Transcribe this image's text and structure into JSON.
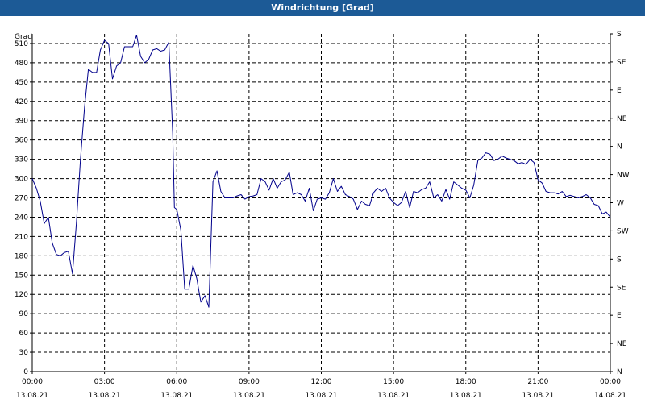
{
  "title": "Windrichtung [Grad]",
  "chart_data": {
    "type": "line",
    "title": "Windrichtung [Grad]",
    "ylabel": "Grad",
    "ylim": [
      0,
      525
    ],
    "yticks": [
      0,
      30,
      60,
      90,
      120,
      150,
      180,
      210,
      240,
      270,
      300,
      330,
      360,
      390,
      420,
      450,
      480,
      510
    ],
    "right_axis_labels": [
      {
        "value": 0,
        "label": "N"
      },
      {
        "value": 45,
        "label": "NE"
      },
      {
        "value": 90,
        "label": "E"
      },
      {
        "value": 135,
        "label": "SE"
      },
      {
        "value": 180,
        "label": "S"
      },
      {
        "value": 225,
        "label": "SW"
      },
      {
        "value": 270,
        "label": "W"
      },
      {
        "value": 315,
        "label": "NW"
      },
      {
        "value": 360,
        "label": "N"
      },
      {
        "value": 405,
        "label": "NE"
      },
      {
        "value": 450,
        "label": "E"
      },
      {
        "value": 495,
        "label": "SE"
      },
      {
        "value": 540,
        "label": "S"
      }
    ],
    "xlim": [
      0,
      24
    ],
    "xticks": [
      {
        "hour": 0,
        "time": "00:00",
        "date": "13.08.21"
      },
      {
        "hour": 3,
        "time": "03:00",
        "date": "13.08.21"
      },
      {
        "hour": 6,
        "time": "06:00",
        "date": "13.08.21"
      },
      {
        "hour": 9,
        "time": "09:00",
        "date": "13.08.21"
      },
      {
        "hour": 12,
        "time": "12:00",
        "date": "13.08.21"
      },
      {
        "hour": 15,
        "time": "15:00",
        "date": "13.08.21"
      },
      {
        "hour": 18,
        "time": "18:00",
        "date": "13.08.21"
      },
      {
        "hour": 21,
        "time": "21:00",
        "date": "13.08.21"
      },
      {
        "hour": 24,
        "time": "00:00",
        "date": "14.08.21"
      }
    ],
    "grid": true,
    "series": [
      {
        "color": "#00008b",
        "points": [
          [
            0.0,
            300
          ],
          [
            0.17,
            285
          ],
          [
            0.33,
            265
          ],
          [
            0.5,
            230
          ],
          [
            0.67,
            240
          ],
          [
            0.83,
            200
          ],
          [
            1.0,
            182
          ],
          [
            1.17,
            180
          ],
          [
            1.33,
            185
          ],
          [
            1.5,
            187
          ],
          [
            1.67,
            152
          ],
          [
            1.83,
            230
          ],
          [
            2.0,
            330
          ],
          [
            2.17,
            410
          ],
          [
            2.33,
            470
          ],
          [
            2.5,
            465
          ],
          [
            2.67,
            465
          ],
          [
            2.83,
            500
          ],
          [
            3.0,
            515
          ],
          [
            3.17,
            510
          ],
          [
            3.33,
            455
          ],
          [
            3.5,
            475
          ],
          [
            3.67,
            480
          ],
          [
            3.83,
            505
          ],
          [
            4.0,
            505
          ],
          [
            4.17,
            505
          ],
          [
            4.33,
            523
          ],
          [
            4.5,
            490
          ],
          [
            4.67,
            480
          ],
          [
            4.83,
            485
          ],
          [
            5.0,
            500
          ],
          [
            5.17,
            502
          ],
          [
            5.33,
            498
          ],
          [
            5.5,
            500
          ],
          [
            5.67,
            512
          ],
          [
            5.83,
            370
          ],
          [
            5.9,
            255
          ],
          [
            6.0,
            252
          ],
          [
            6.17,
            220
          ],
          [
            6.33,
            128
          ],
          [
            6.5,
            128
          ],
          [
            6.67,
            165
          ],
          [
            6.83,
            145
          ],
          [
            7.0,
            108
          ],
          [
            7.17,
            118
          ],
          [
            7.33,
            100
          ],
          [
            7.5,
            295
          ],
          [
            7.67,
            312
          ],
          [
            7.83,
            280
          ],
          [
            8.0,
            270
          ],
          [
            8.17,
            270
          ],
          [
            8.33,
            270
          ],
          [
            8.5,
            273
          ],
          [
            8.67,
            275
          ],
          [
            8.83,
            268
          ],
          [
            9.0,
            272
          ],
          [
            9.17,
            273
          ],
          [
            9.33,
            275
          ],
          [
            9.5,
            300
          ],
          [
            9.67,
            295
          ],
          [
            9.83,
            282
          ],
          [
            10.0,
            300
          ],
          [
            10.17,
            285
          ],
          [
            10.33,
            295
          ],
          [
            10.5,
            298
          ],
          [
            10.67,
            310
          ],
          [
            10.83,
            275
          ],
          [
            11.0,
            278
          ],
          [
            11.17,
            275
          ],
          [
            11.33,
            265
          ],
          [
            11.5,
            285
          ],
          [
            11.67,
            250
          ],
          [
            11.83,
            268
          ],
          [
            12.0,
            270
          ],
          [
            12.17,
            268
          ],
          [
            12.33,
            278
          ],
          [
            12.5,
            300
          ],
          [
            12.67,
            280
          ],
          [
            12.83,
            288
          ],
          [
            13.0,
            275
          ],
          [
            13.17,
            272
          ],
          [
            13.33,
            268
          ],
          [
            13.5,
            252
          ],
          [
            13.67,
            265
          ],
          [
            13.83,
            260
          ],
          [
            14.0,
            258
          ],
          [
            14.17,
            278
          ],
          [
            14.33,
            285
          ],
          [
            14.5,
            280
          ],
          [
            14.67,
            285
          ],
          [
            14.83,
            270
          ],
          [
            15.0,
            263
          ],
          [
            15.17,
            258
          ],
          [
            15.33,
            263
          ],
          [
            15.5,
            280
          ],
          [
            15.67,
            255
          ],
          [
            15.83,
            280
          ],
          [
            16.0,
            278
          ],
          [
            16.17,
            283
          ],
          [
            16.33,
            285
          ],
          [
            16.5,
            295
          ],
          [
            16.67,
            270
          ],
          [
            16.83,
            275
          ],
          [
            17.0,
            265
          ],
          [
            17.17,
            283
          ],
          [
            17.33,
            268
          ],
          [
            17.5,
            295
          ],
          [
            17.67,
            290
          ],
          [
            17.83,
            285
          ],
          [
            18.0,
            282
          ],
          [
            18.17,
            270
          ],
          [
            18.33,
            290
          ],
          [
            18.5,
            328
          ],
          [
            18.67,
            332
          ],
          [
            18.83,
            340
          ],
          [
            19.0,
            338
          ],
          [
            19.17,
            328
          ],
          [
            19.33,
            330
          ],
          [
            19.5,
            335
          ],
          [
            19.67,
            332
          ],
          [
            19.83,
            330
          ],
          [
            20.0,
            328
          ],
          [
            20.17,
            323
          ],
          [
            20.33,
            325
          ],
          [
            20.5,
            322
          ],
          [
            20.67,
            330
          ],
          [
            20.83,
            325
          ],
          [
            21.0,
            298
          ],
          [
            21.17,
            293
          ],
          [
            21.33,
            280
          ],
          [
            21.5,
            278
          ],
          [
            21.67,
            278
          ],
          [
            21.83,
            276
          ],
          [
            22.0,
            280
          ],
          [
            22.17,
            272
          ],
          [
            22.33,
            274
          ],
          [
            22.5,
            272
          ],
          [
            22.67,
            270
          ],
          [
            22.83,
            272
          ],
          [
            23.0,
            275
          ],
          [
            23.17,
            270
          ],
          [
            23.33,
            260
          ],
          [
            23.5,
            258
          ],
          [
            23.67,
            245
          ],
          [
            23.83,
            248
          ],
          [
            24.0,
            240
          ]
        ]
      }
    ]
  }
}
